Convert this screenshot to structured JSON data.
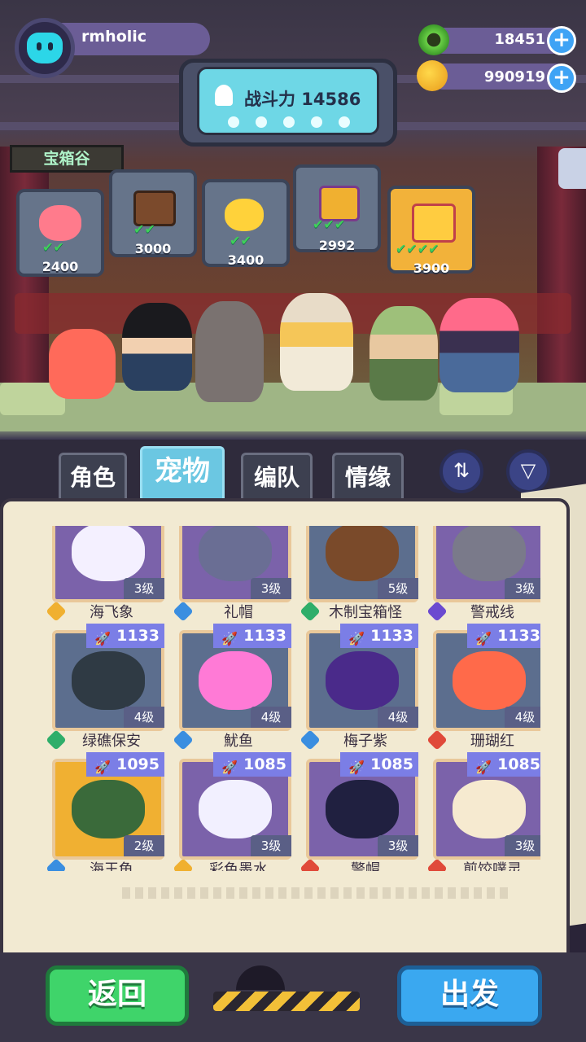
{
  "player": {
    "name": "rmholic"
  },
  "currency": [
    {
      "name": "green-ring-coin",
      "value": "18451"
    },
    {
      "name": "gold-planet-coin",
      "value": "990919"
    }
  ],
  "power": {
    "label": "战斗力 14586",
    "dots": 5
  },
  "area": {
    "label": "宝箱谷"
  },
  "chests": [
    {
      "value": "2400",
      "checks": "✔✔"
    },
    {
      "value": "3000",
      "checks": "✔✔"
    },
    {
      "value": "3400",
      "checks": "✔✔"
    },
    {
      "value": "2992",
      "checks": "✔✔✔"
    },
    {
      "value": "3900",
      "checks": "✔✔✔✔"
    }
  ],
  "tabs": [
    {
      "label": "角色",
      "active": false
    },
    {
      "label": "宠物",
      "active": true
    },
    {
      "label": "编队",
      "active": false
    },
    {
      "label": "情缘",
      "active": false
    }
  ],
  "controls": {
    "sort_icon": "swap-vertical-icon",
    "filter_icon": "filter-icon"
  },
  "pets": [
    {
      "name": "海飞象",
      "level": "3级",
      "power": "",
      "element": "gold",
      "tile": "purple"
    },
    {
      "name": "礼帽",
      "level": "3级",
      "power": "",
      "element": "blue",
      "tile": "purple"
    },
    {
      "name": "木制宝箱怪",
      "level": "5级",
      "power": "",
      "element": "green",
      "tile": "blue"
    },
    {
      "name": "警戒线",
      "level": "3级",
      "power": "",
      "element": "purple",
      "tile": "purple"
    },
    {
      "name": "绿礁保安",
      "level": "4级",
      "power": "1133",
      "element": "green",
      "tile": "blue"
    },
    {
      "name": "魷鱼",
      "level": "4级",
      "power": "1133",
      "element": "blue",
      "tile": "blue"
    },
    {
      "name": "梅子紫",
      "level": "4级",
      "power": "1133",
      "element": "blue",
      "tile": "blue"
    },
    {
      "name": "珊瑚红",
      "level": "4级",
      "power": "1133",
      "element": "red",
      "tile": "blue"
    },
    {
      "name": "海王龟",
      "level": "2级",
      "power": "1095",
      "element": "blue",
      "tile": "gold"
    },
    {
      "name": "彩色墨水",
      "level": "3级",
      "power": "1085",
      "element": "gold",
      "tile": "purple"
    },
    {
      "name": "警帽",
      "level": "3级",
      "power": "1085",
      "element": "red",
      "tile": "purple"
    },
    {
      "name": "煎饺噗灵",
      "level": "3级",
      "power": "1085",
      "element": "red",
      "tile": "purple"
    }
  ],
  "buttons": {
    "back": "返回",
    "go": "出发"
  }
}
